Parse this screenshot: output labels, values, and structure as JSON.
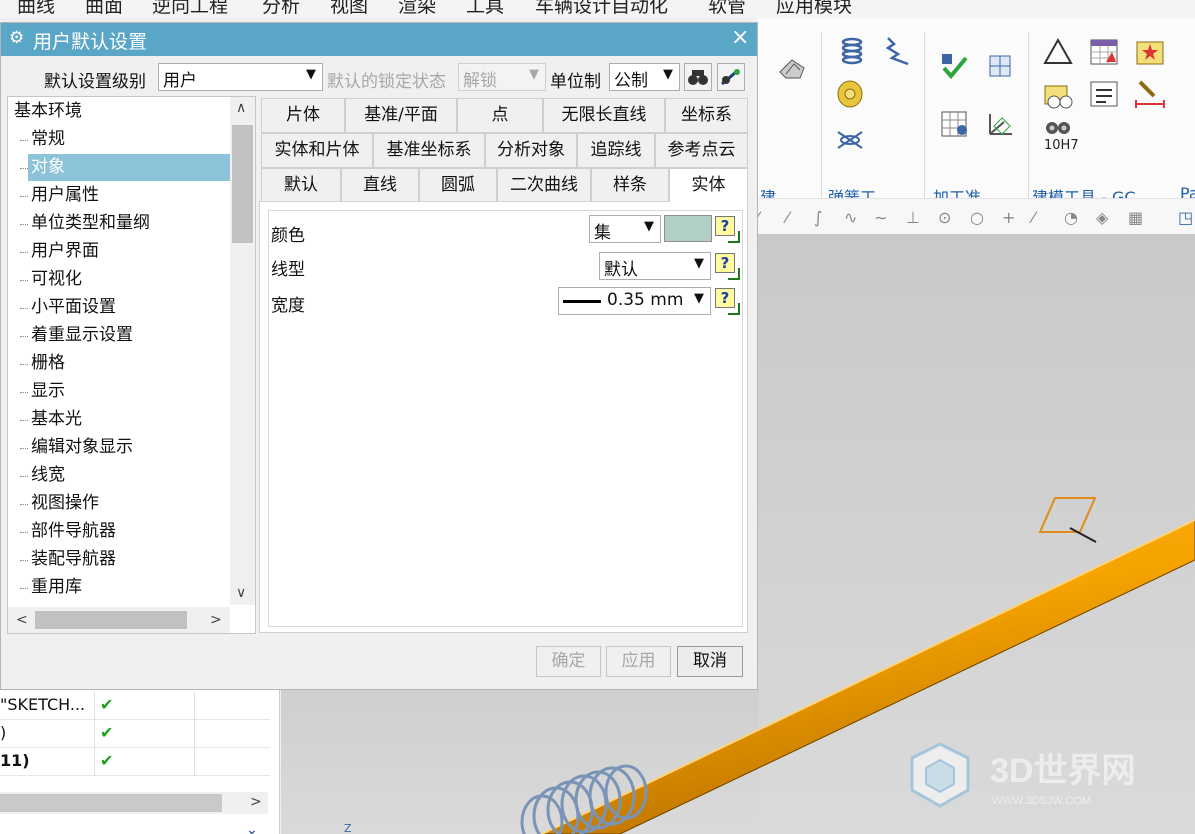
{
  "menubar": {
    "items": [
      "曲线",
      "曲面",
      "逆向工程",
      "分析",
      "视图",
      "渲染",
      "工具",
      "车辆设计自动化",
      "软管",
      "应用模块"
    ]
  },
  "ribbon": {
    "groups": [
      {
        "label": "建...",
        "icons": [
          "blend-icon"
        ]
      },
      {
        "label": "弹簧工...",
        "icons": [
          "coil-spring-icon",
          "compression-spring-icon",
          "washer-icon",
          "disc-spring-icon"
        ]
      },
      {
        "label": "加工准...",
        "icons": [
          "check-feature-icon",
          "measure-icon",
          "table-icon",
          "coordinate-icon"
        ]
      },
      {
        "label": "建模工具 - GC...",
        "icons": [
          "triangle-icon",
          "spreadsheet-icon",
          "star-pattern-icon",
          "sketch-icon",
          "note-icon",
          "dimension-brush-icon",
          "hole-fit-icon"
        ]
      }
    ],
    "partial_label": "Pa",
    "hole_fit_text": "10H7"
  },
  "dialog": {
    "title": "用户默认设置",
    "level_label": "默认设置级别",
    "level_value": "用户",
    "lock_label": "默认的锁定状态",
    "lock_value": "解锁",
    "unit_label": "单位制",
    "unit_value": "公制",
    "tree": {
      "root": "基本环境",
      "items": [
        "常规",
        "对象",
        "用户属性",
        "单位类型和量纲",
        "用户界面",
        "可视化",
        "小平面设置",
        "着重显示设置",
        "栅格",
        "显示",
        "基本光",
        "编辑对象显示",
        "线宽",
        "视图操作",
        "部件导航器",
        "装配导航器",
        "重用库"
      ],
      "selected": "对象"
    },
    "tabs": {
      "row1": [
        "片体",
        "基准/平面",
        "点",
        "无限长直线",
        "坐标系"
      ],
      "row2": [
        "实体和片体",
        "基准坐标系",
        "分析对象",
        "追踪线",
        "参考点云"
      ],
      "row3": [
        "默认",
        "直线",
        "圆弧",
        "二次曲线",
        "样条",
        "实体"
      ],
      "active": "实体"
    },
    "props": {
      "color_label": "颜色",
      "color_combo": "集",
      "color_swatch": "#b1cfc5",
      "linetype_label": "线型",
      "linetype_value": "默认",
      "width_label": "宽度",
      "width_value": "0.35 mm",
      "help": "?"
    },
    "buttons": {
      "ok": "确定",
      "apply": "应用",
      "cancel": "取消"
    }
  },
  "navigator": {
    "rows": [
      {
        "name": "\"SKETCH...",
        "check": "✔"
      },
      {
        "name": ")",
        "check": "✔"
      },
      {
        "name": "11)",
        "check": "✔"
      }
    ]
  },
  "viewport": {
    "axis_label": "Z",
    "watermark_text": "3D世界网",
    "watermark_sub": "WWW.3DSJW.COM"
  }
}
